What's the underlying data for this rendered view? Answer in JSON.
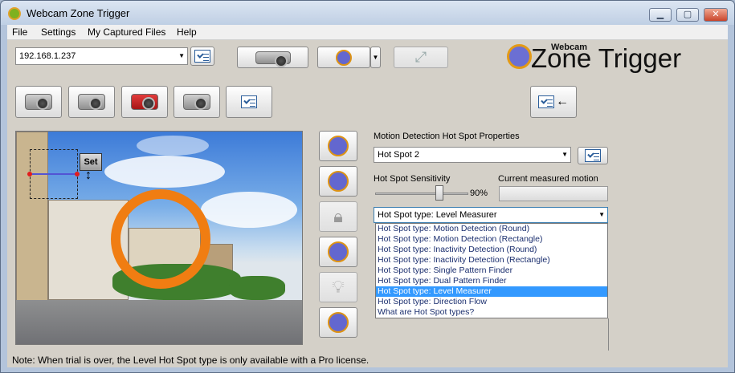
{
  "window": {
    "title": "Webcam Zone Trigger",
    "controls": [
      "minimize",
      "maximize",
      "close"
    ]
  },
  "menu": [
    "File",
    "Settings",
    "My Captured Files",
    "Help"
  ],
  "toolbar": {
    "camera_address": "192.168.1.237"
  },
  "logo": {
    "small": "Webcam",
    "large": "Zone Trigger"
  },
  "preview": {
    "set_label": "Set"
  },
  "hotspot_panel": {
    "properties_title": "Motion Detection Hot Spot Properties",
    "selected_hotspot": "Hot Spot 2",
    "sensitivity_label": "Hot Spot Sensitivity",
    "sensitivity_value": "90%",
    "current_motion_label": "Current measured motion",
    "type_selected": "Hot Spot type: Level Measurer",
    "type_options": [
      "Hot Spot type: Motion Detection (Round)",
      "Hot Spot type: Motion Detection (Rectangle)",
      "Hot Spot type: Inactivity Detection (Round)",
      "Hot Spot type: Inactivity Detection (Rectangle)",
      "Hot Spot type: Single Pattern Finder",
      "Hot Spot type: Dual Pattern Finder",
      "Hot Spot type: Level Measurer",
      "Hot Spot type: Direction Flow",
      "What are Hot Spot types?"
    ],
    "selected_option_index": 6
  },
  "status": {
    "note": "Note: When trial is over, the Level Hot Spot type is only available with a Pro license."
  },
  "colors": {
    "hotspot_ring": "#f07d12",
    "logo_circle": "#6b6fd3",
    "selection_highlight": "#3399ff"
  }
}
